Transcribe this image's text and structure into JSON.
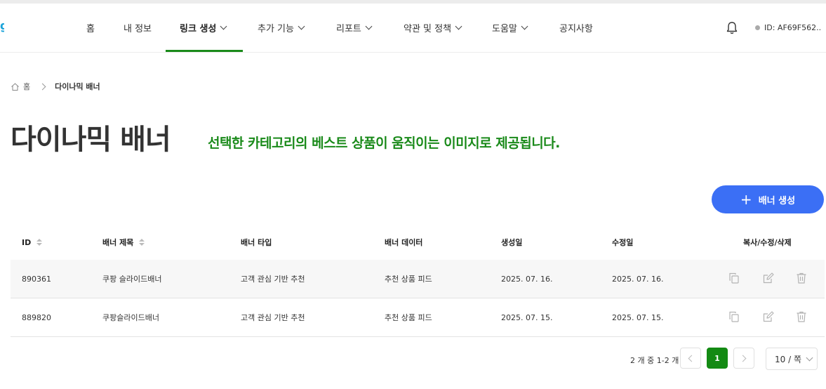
{
  "header": {
    "logo_char": "g",
    "nav": [
      {
        "label": "홈",
        "dropdown": false,
        "active": false
      },
      {
        "label": "내 정보",
        "dropdown": false,
        "active": false
      },
      {
        "label": "링크 생성",
        "dropdown": true,
        "active": true
      },
      {
        "label": "추가 기능",
        "dropdown": true,
        "active": false
      },
      {
        "label": "리포트",
        "dropdown": true,
        "active": false
      },
      {
        "label": "약관 및 정책",
        "dropdown": true,
        "active": false
      },
      {
        "label": "도움말",
        "dropdown": true,
        "active": false
      },
      {
        "label": "공지사항",
        "dropdown": false,
        "active": false
      }
    ],
    "user_id": "ID: AF69F562..",
    "accent_color": "#1a8a1a"
  },
  "breadcrumb": {
    "home": "홈",
    "current": "다이나믹 배너"
  },
  "page": {
    "title": "다이나믹 배너",
    "subtitle": "선택한 카테고리의 베스트 상품이 움직이는 이미지로 제공됩니다."
  },
  "create_button": {
    "label": "배너 생성",
    "color": "#3b6ff5"
  },
  "table": {
    "columns": [
      "ID",
      "배너 제목",
      "배너 타입",
      "배너 데이터",
      "생성일",
      "수정일",
      "복사/수정/삭제"
    ],
    "rows": [
      {
        "id": "890361",
        "title": "쿠팡 슬라이드배너",
        "type": "고객 관심 기반 추천",
        "data": "추천 상품 피드",
        "created": "2025. 07. 16.",
        "updated": "2025. 07. 16."
      },
      {
        "id": "889820",
        "title": "쿠팡슬라이드배너",
        "type": "고객 관심 기반 추천",
        "data": "추천 상품 피드",
        "created": "2025. 07. 15.",
        "updated": "2025. 07. 15."
      }
    ]
  },
  "pagination": {
    "info": "2 개 중 1-2 개",
    "current_page": "1",
    "page_size": "10 / 쪽",
    "current_color": "#138a13"
  }
}
